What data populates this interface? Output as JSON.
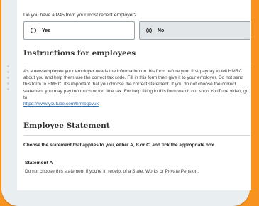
{
  "question": "Do you have a P45 from your most recent employer?",
  "options": [
    {
      "label": "Yes",
      "selected": false
    },
    {
      "label": "No",
      "selected": true
    }
  ],
  "instructions": {
    "heading": "Instructions for employees",
    "body": "As a new employee your employer needs the information on this form before your first payday to tell HMRC about you and help them use the correct tax code. Fill in this form then give it to your employer. Do not send this form to HMRC. It's important that you choose the correct statement. If you do not choose the correct statement you may pay too much or too little tax. For help filling in this form watch our short YouTube video, go to",
    "link": "https://www.youtube.com/hmrcgovuk"
  },
  "employee_statement": {
    "heading": "Employee Statement",
    "instruction": "Choose the statement that applies to you, either A, B or C, and tick the appropriate box.",
    "statement_a_title": "Statement A",
    "statement_a_text": "Do not choose this statement if you're in receipt of a State, Works or Private Pension."
  },
  "colors": {
    "background": "#f7931e",
    "link": "#2f6fb0"
  }
}
